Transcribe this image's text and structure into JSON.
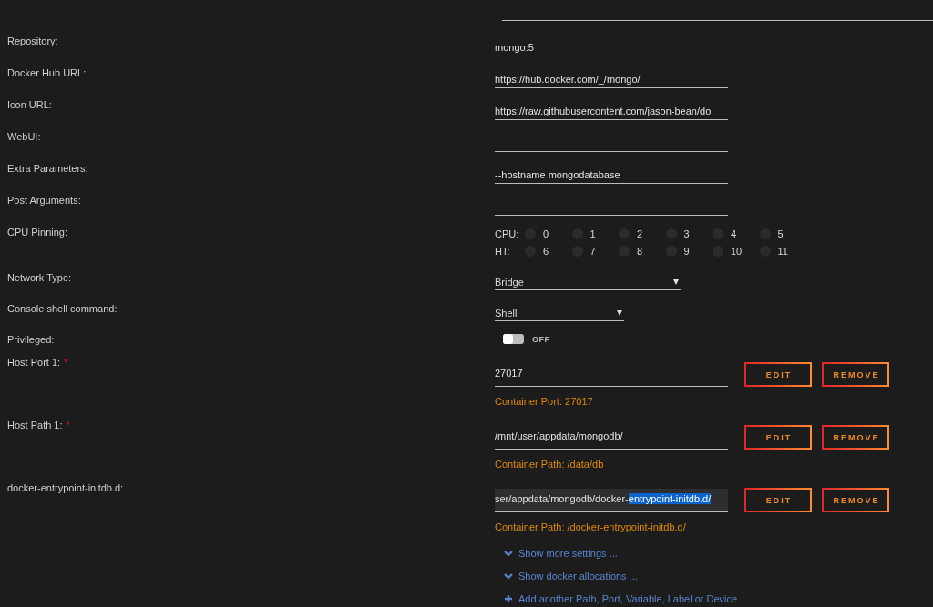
{
  "settings": [
    {
      "kind": "text",
      "label": "Repository:",
      "value": "mongo:5"
    },
    {
      "kind": "text",
      "label": "Docker Hub URL:",
      "value": "https://hub.docker.com/_/mongo/"
    },
    {
      "kind": "text",
      "label": "Icon URL:",
      "value": "https://raw.githubusercontent.com/jason-bean/do"
    },
    {
      "kind": "text",
      "label": "WebUI:"
    },
    {
      "kind": "text",
      "label": "Extra Parameters:",
      "value": "--hostname mongodatabase"
    },
    {
      "kind": "text",
      "label": "Post Arguments:"
    },
    {
      "kind": "cpu",
      "label": "CPU Pinning:",
      "groups": [
        {
          "label": "CPU:",
          "cores": [
            {
              "number": "0",
              "checked": false
            },
            {
              "number": "1",
              "checked": false
            },
            {
              "number": "2",
              "checked": false
            },
            {
              "number": "3",
              "checked": false
            },
            {
              "number": "4",
              "checked": false
            },
            {
              "number": "5",
              "checked": false
            }
          ]
        },
        {
          "label": "HT:",
          "cores": [
            {
              "number": "6",
              "checked": false
            },
            {
              "number": "7",
              "checked": false
            },
            {
              "number": "8",
              "checked": false
            },
            {
              "number": "9",
              "checked": false
            },
            {
              "number": "10",
              "checked": false
            },
            {
              "number": "11",
              "checked": false
            }
          ]
        }
      ]
    },
    {
      "kind": "select",
      "label": "Network Type:",
      "value": "Bridge"
    },
    {
      "kind": "select",
      "label": "Console shell command:",
      "value": "Shell"
    },
    {
      "kind": "toggle",
      "label": "Privileged:",
      "on": false,
      "state_text": "OFF"
    },
    {
      "kind": "mapping",
      "label": "Host Port 1:",
      "required": true,
      "focused": false,
      "value_parts": [
        {
          "text": "27017",
          "highlighted": false
        }
      ],
      "note": "Container Port: 27017",
      "buttons": [
        "EDIT",
        "REMOVE"
      ]
    },
    {
      "kind": "mapping",
      "label": "Host Path 1:",
      "required": true,
      "focused": false,
      "value_parts": [
        {
          "text": "/mnt/user/appdata/mongodb/",
          "highlighted": false
        }
      ],
      "note": "Container Path: /data/db",
      "buttons": [
        "EDIT",
        "REMOVE"
      ]
    },
    {
      "kind": "mapping",
      "label": "docker-entrypoint-initdb.d:",
      "required": false,
      "focused": true,
      "value_parts": [
        {
          "text": "ser/appdata/mongodb/docker-",
          "highlighted": false
        },
        {
          "text": "entrypoint-initdb.d/",
          "highlighted": true
        }
      ],
      "note": "Container Path: /docker-entrypoint-initdb.d/",
      "buttons": [
        "EDIT",
        "REMOVE"
      ]
    }
  ],
  "links": [
    {
      "kind": "expand",
      "text": "Show more settings ..."
    },
    {
      "kind": "expand",
      "text": "Show docker allocations ..."
    },
    {
      "kind": "add",
      "text": "Add another Path, Port, Variable, Label or Device"
    }
  ],
  "required_mark": "*"
}
